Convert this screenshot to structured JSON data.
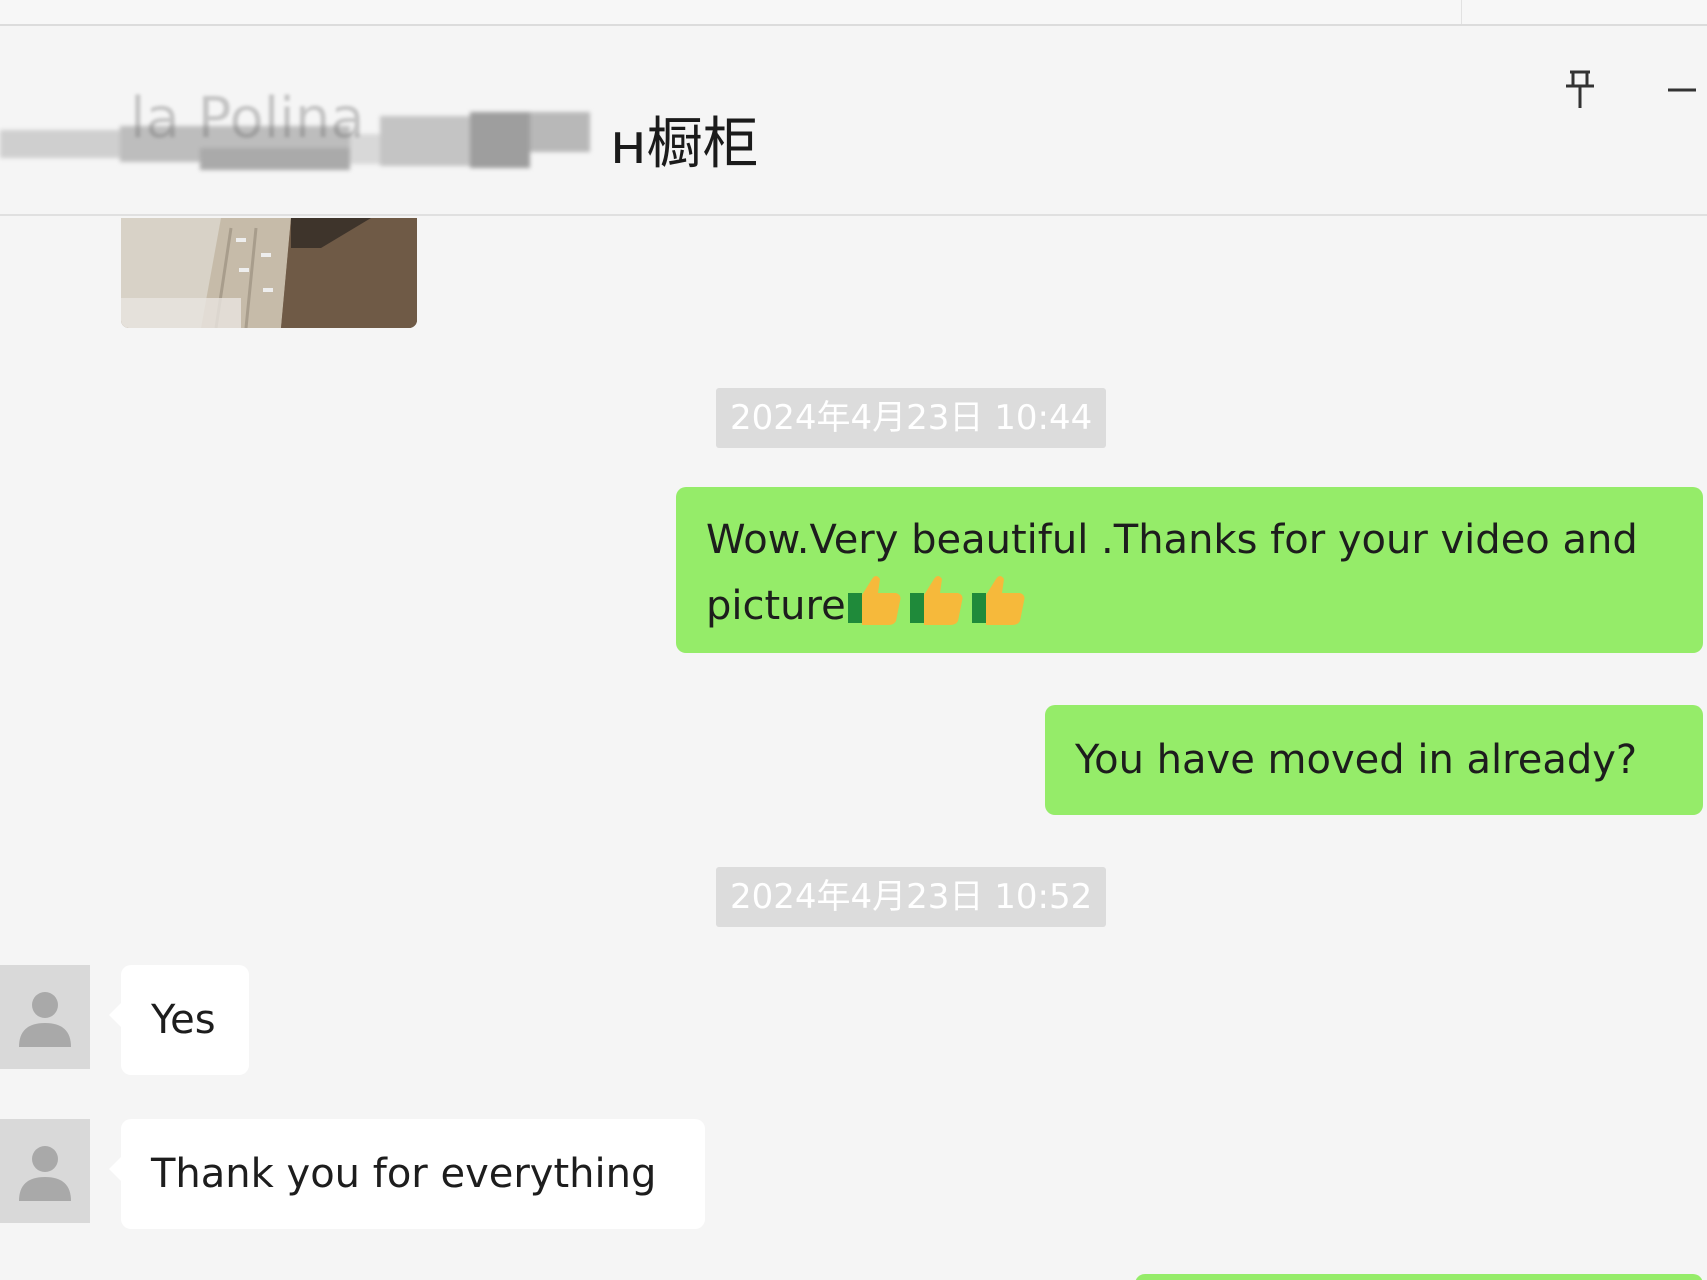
{
  "window": {
    "title": "…la Polina…н橱柜",
    "title_visible_suffix": "н橱柜",
    "title_visible_prefix": "la Polina"
  },
  "toolbar": {
    "pin_icon": "pin-icon",
    "minimize_icon": "minimize-icon"
  },
  "messages": [
    {
      "type": "image",
      "direction": "in",
      "description_icon": "image-thumbnail"
    },
    {
      "type": "timestamp",
      "text": "2024年4月23日 10:44"
    },
    {
      "type": "text",
      "direction": "out",
      "text_line1": "Wow.Very beautiful .Thanks for your video and",
      "text_line2": "picture",
      "emoji": "👍👍👍"
    },
    {
      "type": "text",
      "direction": "out",
      "text": "You have moved in already?"
    },
    {
      "type": "timestamp",
      "text": "2024年4月23日 10:52"
    },
    {
      "type": "text",
      "direction": "in",
      "text": "Yes"
    },
    {
      "type": "text",
      "direction": "in",
      "text": "Thank you for everything"
    }
  ],
  "colors": {
    "outgoing_bubble": "#95ec69",
    "incoming_bubble": "#ffffff",
    "background": "#f5f5f5",
    "timestamp_bg": "#dcdcdc"
  }
}
